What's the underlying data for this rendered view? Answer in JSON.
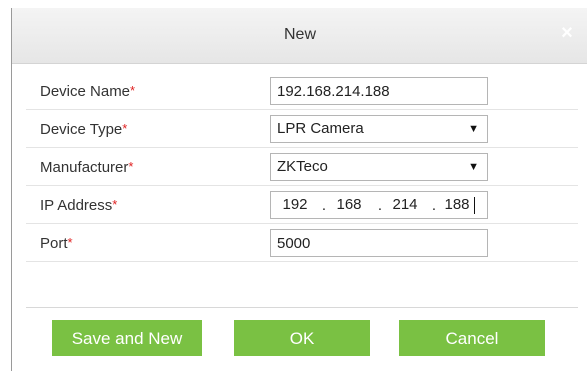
{
  "dialog": {
    "title": "New",
    "close_glyph": "×"
  },
  "form": {
    "device_name": {
      "label": "Device Name",
      "required": "*",
      "value": "192.168.214.188"
    },
    "device_type": {
      "label": "Device Type",
      "required": "*",
      "value": "LPR Camera"
    },
    "manufacturer": {
      "label": "Manufacturer",
      "required": "*",
      "value": "ZKTeco"
    },
    "ip_address": {
      "label": "IP Address",
      "required": "*",
      "octets": [
        "192",
        "168",
        "214",
        "188"
      ],
      "separator": "."
    },
    "port": {
      "label": "Port",
      "required": "*",
      "value": "5000"
    }
  },
  "buttons": {
    "save_and_new": "Save and New",
    "ok": "OK",
    "cancel": "Cancel"
  },
  "icons": {
    "dropdown": "chevron-down-icon",
    "close": "close-icon"
  },
  "colors": {
    "button": "#7ac143",
    "required": "#e02020",
    "close": "#ffffff"
  }
}
